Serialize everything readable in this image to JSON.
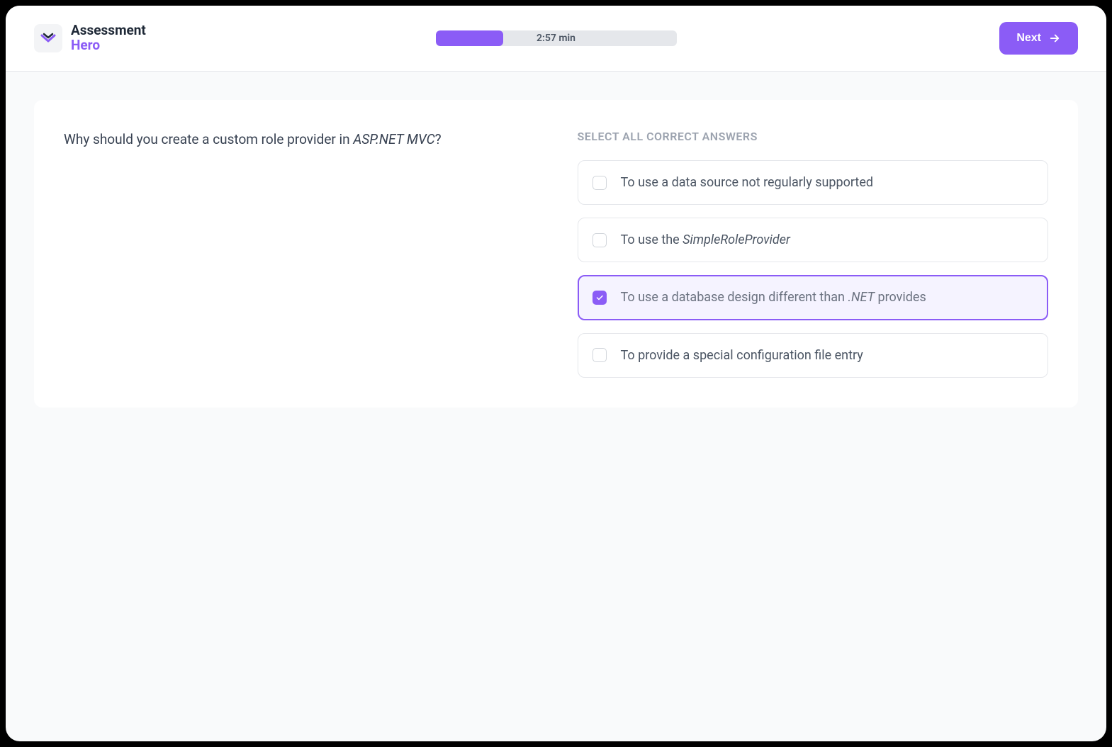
{
  "header": {
    "logo": {
      "text_top": "Assessment",
      "text_bottom": "Hero"
    },
    "progress": {
      "time_text": "2:57 min",
      "percent": 28
    },
    "next_button_label": "Next"
  },
  "question": {
    "prefix": "Why should you create a custom role provider in ",
    "italic": "ASP.NET MVC",
    "suffix": "?"
  },
  "answers": {
    "label": "SELECT ALL CORRECT ANSWERS",
    "options": [
      {
        "text": "To use a data source not regularly supported",
        "selected": false
      },
      {
        "prefix": "To use the ",
        "italic": "SimpleRoleProvider",
        "suffix": "",
        "selected": false
      },
      {
        "prefix": "To use a database design different than ",
        "italic": ".NET",
        "suffix": " provides",
        "selected": true
      },
      {
        "text": "To provide a special configuration file entry",
        "selected": false
      }
    ]
  }
}
